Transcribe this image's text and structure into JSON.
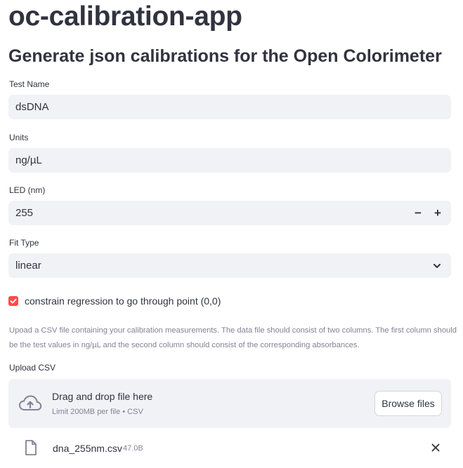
{
  "app_title": "oc-calibration-app",
  "subtitle": "Generate json calibrations for the Open Colorimeter",
  "test_name": {
    "label": "Test Name",
    "value": "dsDNA"
  },
  "units": {
    "label": "Units",
    "value": "ng/µL"
  },
  "led": {
    "label": "LED (nm)",
    "value": "255",
    "decrement": "−",
    "increment": "+"
  },
  "fit_type": {
    "label": "Fit Type",
    "value": "linear"
  },
  "constrain": {
    "label": "constrain regression to go through point (0,0)",
    "checked": true
  },
  "help_text": "Upoad a CSV file containing your calibration measurements. The data file should consist of two columns. The first column should be the test values in ng/µL and the second column should consist of the corresponding absorbances.",
  "upload": {
    "label": "Upload CSV",
    "drop_title": "Drag and drop file here",
    "limit": "Limit 200MB per file • CSV",
    "browse_label": "Browse files"
  },
  "file": {
    "name": "dna_255nm.csv",
    "size": "47.0B"
  },
  "colors": {
    "accent": "#ff4b4b",
    "field_bg": "#f0f2f6",
    "text": "#31333f",
    "muted": "#808495"
  },
  "icons": {
    "upload": "cloud-upload-icon",
    "file": "file-icon",
    "close": "close-icon",
    "chevron": "chevron-down-icon",
    "check": "checkmark-icon"
  }
}
